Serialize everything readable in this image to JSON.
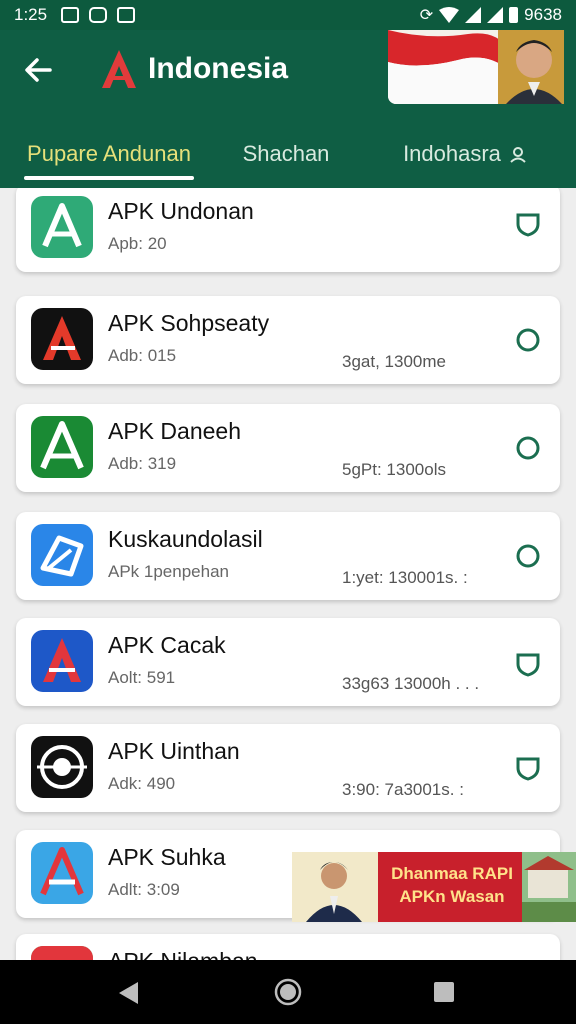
{
  "status": {
    "time": "1:25",
    "battery": "9638"
  },
  "app": {
    "title": "Indonesia"
  },
  "tabs": [
    {
      "label": "Pupare Andunan"
    },
    {
      "label": "Shachan"
    },
    {
      "label": "Indohasra"
    }
  ],
  "apps": [
    {
      "name": "APK Undonan",
      "sub": "Apb: 20",
      "size": ""
    },
    {
      "name": "APK Sohpseaty",
      "sub": "Adb: 015",
      "size": "3gat, 1300me"
    },
    {
      "name": "APK Daneeh",
      "sub": "Adb: 319",
      "size": "5gPt: 1300ols"
    },
    {
      "name": "Kuskaundolasil",
      "sub": "APk 1penpehan",
      "size": "1:yet: 130001s. :"
    },
    {
      "name": "APK Cacak",
      "sub": "Aolt: 591",
      "size": "33g63 13000h . . ."
    },
    {
      "name": "APK Uinthan",
      "sub": "Adk: 490",
      "size": "3:90: 7a3001s. :"
    },
    {
      "name": "APK Suhka",
      "sub": "Adlt: 3:09",
      "size": ""
    },
    {
      "name": "APK Nilamban",
      "sub": "",
      "size": ""
    }
  ],
  "ad": {
    "text": "Dhanmaa RAPI APKn Wasan"
  },
  "colors": {
    "appbar": "#0f5e44",
    "statusbar": "#0d5a3e",
    "accent": "#1b6e50",
    "tab_active": "#e6e07a"
  }
}
